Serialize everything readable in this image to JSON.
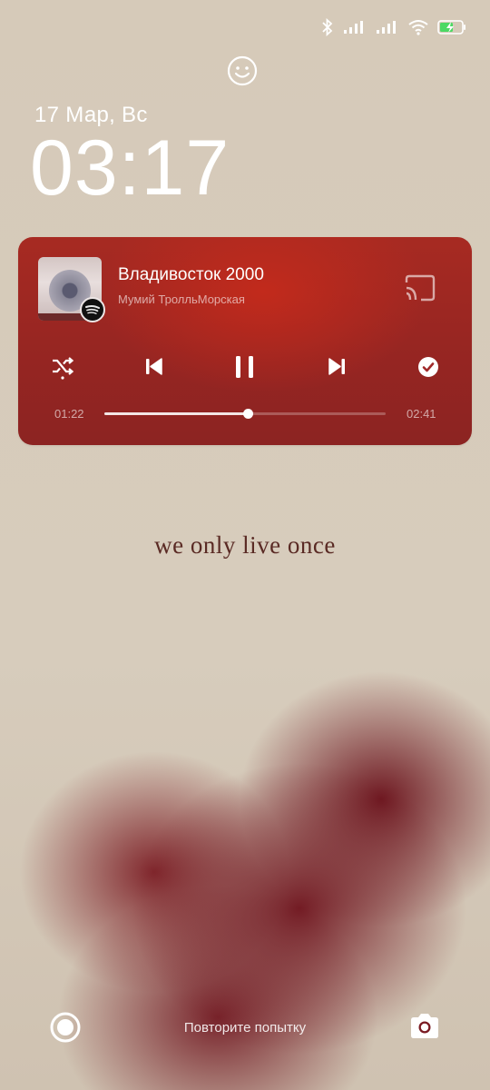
{
  "lockscreen": {
    "date": "17 Мар, Вс",
    "time": "03:17",
    "quote": "we only live once",
    "hint": "Повторите попытку"
  },
  "status_bar": {
    "icons": [
      "bluetooth-icon",
      "signal-icon",
      "signal-icon",
      "wifi-icon",
      "battery-charging-icon"
    ],
    "battery_color": "#4cd964"
  },
  "player": {
    "song": "Владивосток 2000",
    "artist": "Мумий ТролльМорская",
    "elapsed": "01:22",
    "total": "02:41",
    "progress": 0.51,
    "accent": "#a72a22",
    "controls": [
      "shuffle-icon",
      "previous-icon",
      "pause-icon",
      "next-icon",
      "check-icon"
    ],
    "source_icon": "spotify-icon"
  },
  "colors": {
    "background": "#d8cdbd",
    "heart": "#7a1620",
    "quote": "#5a2a24"
  }
}
